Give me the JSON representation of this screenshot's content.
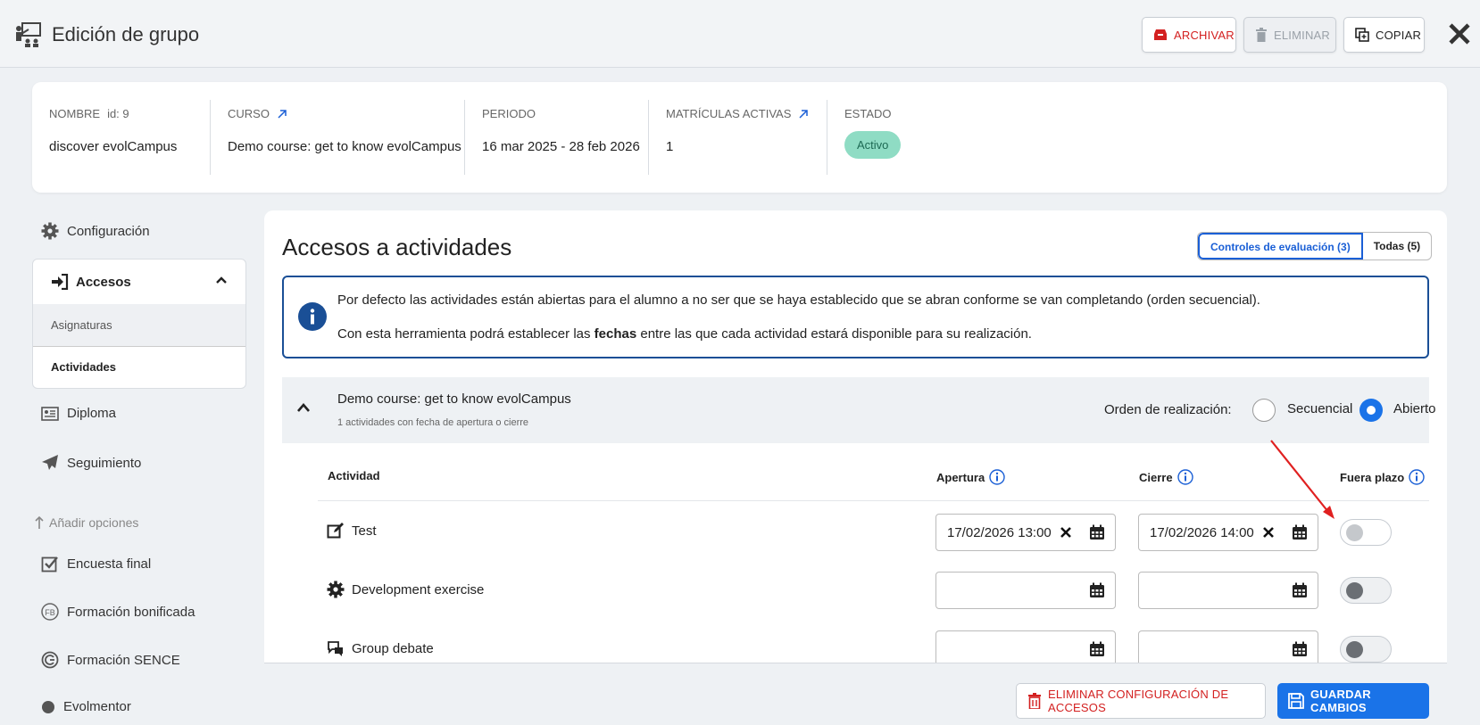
{
  "header": {
    "title": "Edición de grupo",
    "buttons": {
      "archive": "ARCHIVAR",
      "delete": "ELIMINAR",
      "copy": "COPIAR"
    }
  },
  "info": {
    "nombre_label": "NOMBRE",
    "id_label": "id: 9",
    "nombre": "discover evolCampus",
    "curso_label": "CURSO",
    "curso": "Demo course: get to know evolCampus",
    "periodo_label": "PERIODO",
    "periodo": "16 mar 2025 - 28 feb 2026",
    "matriculas_label": "MATRÍCULAS ACTIVAS",
    "matriculas": "1",
    "estado_label": "ESTADO",
    "estado": "Activo"
  },
  "sidebar": {
    "configuracion": "Configuración",
    "accesos": "Accesos",
    "asignaturas": "Asignaturas",
    "actividades": "Actividades",
    "diploma": "Diploma",
    "seguimiento": "Seguimiento",
    "add_options": "Añadir opciones",
    "encuesta": "Encuesta final",
    "bonificada": "Formación bonificada",
    "sence": "Formación SENCE",
    "evolmentor": "Evolmentor"
  },
  "main": {
    "title": "Accesos a actividades",
    "filter_controles": "Controles de evaluación (3)",
    "filter_todas": "Todas (5)",
    "notice_line1": "Por defecto las actividades están abiertas para el alumno a no ser que se haya establecido que se abran conforme se van completando (orden secuencial).",
    "notice_line2_pre": "Con esta herramienta podrá establecer las ",
    "notice_line2_bold": "fechas",
    "notice_line2_post": " entre las que cada actividad estará disponible para su realización.",
    "course_name": "Demo course: get to know evolCampus",
    "course_sub": "1 actividades con fecha de apertura o cierre",
    "orden_label": "Orden de realización:",
    "radio_secuencial": "Secuencial",
    "radio_abierto": "Abierto",
    "col_actividad": "Actividad",
    "col_apertura": "Apertura",
    "col_cierre": "Cierre",
    "col_fuera": "Fuera plazo",
    "rows": [
      {
        "name": "Test",
        "apertura": "17/02/2026 13:00",
        "cierre": "17/02/2026 14:00",
        "fuera_plazo": false
      },
      {
        "name": "Development exercise",
        "apertura": "",
        "cierre": "",
        "fuera_plazo": false
      },
      {
        "name": "Group debate",
        "apertura": "",
        "cierre": "",
        "fuera_plazo": false
      }
    ]
  },
  "footer": {
    "delete_config": "ELIMINAR CONFIGURACIÓN DE ACCESOS",
    "save": "GUARDAR CAMBIOS"
  },
  "colors": {
    "primary": "#1a73e8",
    "danger": "#d32020",
    "active_badge": "#8fdcc4",
    "annotation_arrow": "#e02020"
  }
}
